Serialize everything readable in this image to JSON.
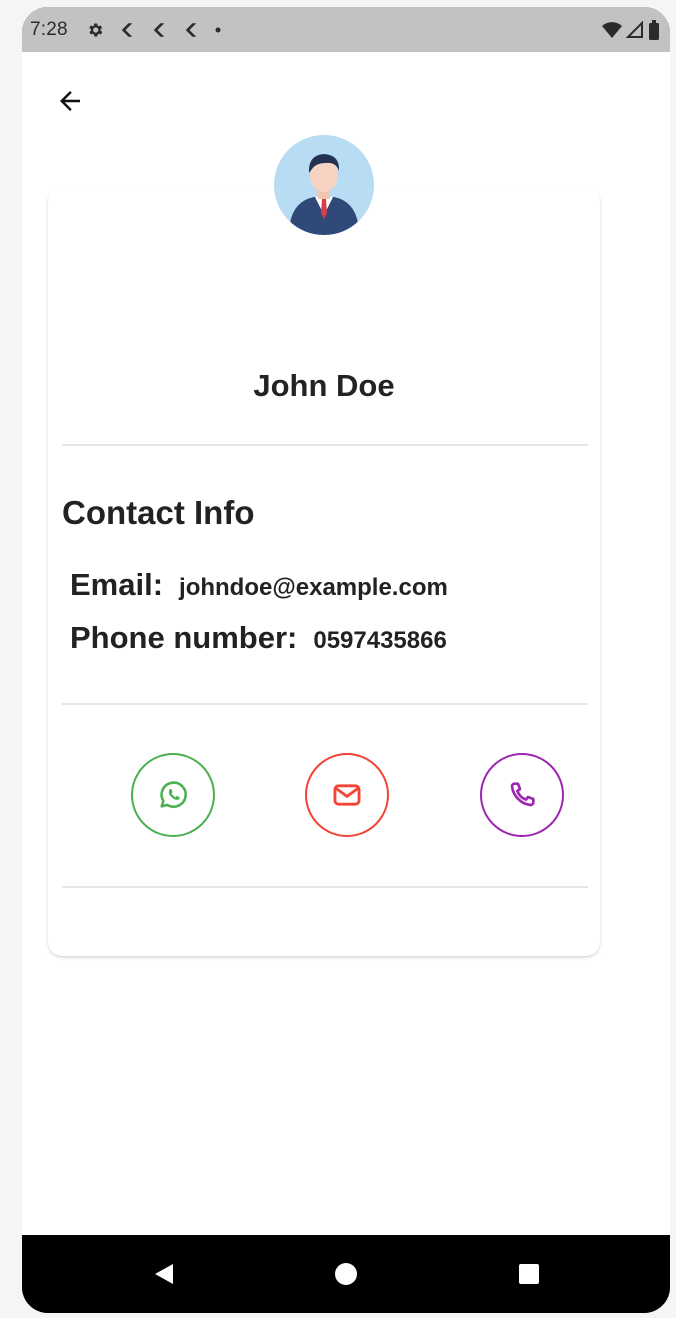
{
  "status_bar": {
    "time": "7:28",
    "icons": [
      "gear-icon",
      "flutter-icon",
      "flutter-icon",
      "flutter-icon",
      "dot-icon"
    ],
    "right_icons": [
      "wifi-icon",
      "signal-icon",
      "battery-icon"
    ]
  },
  "header": {
    "back_icon": "arrow-left-icon"
  },
  "profile": {
    "name": "John Doe",
    "avatar_icon": "businessman-avatar"
  },
  "contact": {
    "title": "Contact Info",
    "email_label": "Email:",
    "email_value": "johndoe@example.com",
    "phone_label": "Phone number:",
    "phone_value": "0597435866"
  },
  "actions": [
    {
      "name": "whatsapp",
      "icon": "whatsapp-icon",
      "color": "#4caf50"
    },
    {
      "name": "email",
      "icon": "mail-icon",
      "color": "#f44336"
    },
    {
      "name": "call",
      "icon": "phone-icon",
      "color": "#9c27b0"
    }
  ],
  "nav": {
    "back": "nav-back-icon",
    "home": "nav-home-icon",
    "recents": "nav-recents-icon"
  },
  "colors": {
    "status_bar_bg": "#c2c2c2",
    "whatsapp": "#4caf50",
    "email": "#f44336",
    "phone": "#9c27b0"
  }
}
